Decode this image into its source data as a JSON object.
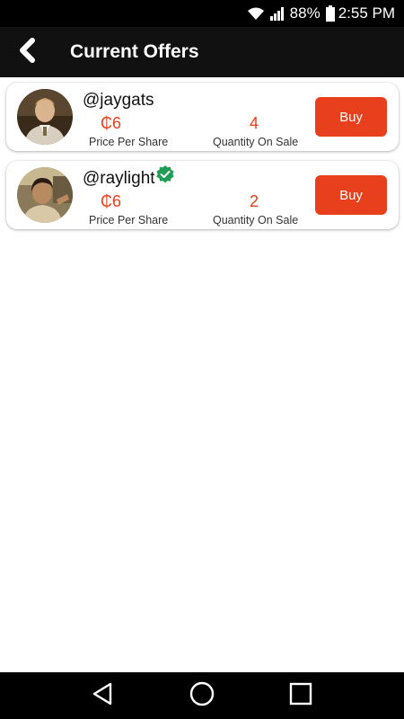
{
  "status_bar": {
    "battery": "88%",
    "time": "2:55 PM",
    "icons": [
      "wifi-icon",
      "signal-icon",
      "battery-icon"
    ]
  },
  "app_bar": {
    "title": "Current Offers",
    "back_icon": "chevron-left-icon"
  },
  "offers": [
    {
      "username": "@jaygats",
      "verified": false,
      "price": "₵6",
      "price_label": "Price Per Share",
      "quantity": "4",
      "quantity_label": "Quantity On Sale",
      "button_label": "Buy"
    },
    {
      "username": "@raylight",
      "verified": true,
      "price": "₵6",
      "price_label": "Price Per Share",
      "quantity": "2",
      "quantity_label": "Quantity On Sale",
      "button_label": "Buy"
    }
  ],
  "nav_bar": {
    "icons": [
      "back-triangle-icon",
      "home-circle-icon",
      "recents-square-icon"
    ]
  },
  "colors": {
    "accent": "#e8401c",
    "app_bar": "#111111",
    "status_bar": "#000000",
    "verified": "#1f9d55"
  }
}
